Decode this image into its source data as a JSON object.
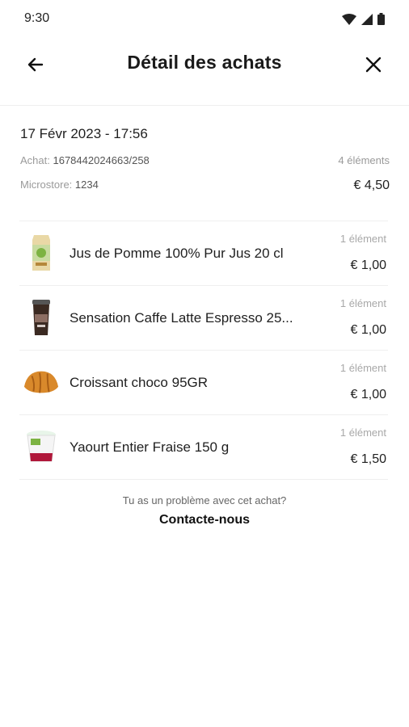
{
  "statusbar": {
    "time": "9:30"
  },
  "appbar": {
    "title": "Détail des achats"
  },
  "summary": {
    "date": "17 Févr 2023 - 17:56",
    "purchase_label": "Achat:",
    "purchase_id": "1678442024663/258",
    "item_count": "4 éléments",
    "store_label": "Microstore:",
    "store_id": "1234",
    "total": "€ 4,50"
  },
  "items": [
    {
      "name": "Jus de Pomme 100% Pur Jus 20 cl",
      "qty": "1 élément",
      "price": "€ 1,00",
      "icon": "juice-carton-icon"
    },
    {
      "name": "Sensation Caffe Latte Espresso 25...",
      "qty": "1 élément",
      "price": "€ 1,00",
      "icon": "coffee-cup-icon"
    },
    {
      "name": "Croissant choco 95GR",
      "qty": "1 élément",
      "price": "€ 1,00",
      "icon": "croissant-icon"
    },
    {
      "name": "Yaourt Entier Fraise 150 g",
      "qty": "1 élément",
      "price": "€ 1,50",
      "icon": "yogurt-icon"
    }
  ],
  "help": {
    "question": "Tu as un problème avec cet achat?",
    "contact": "Contacte-nous"
  }
}
